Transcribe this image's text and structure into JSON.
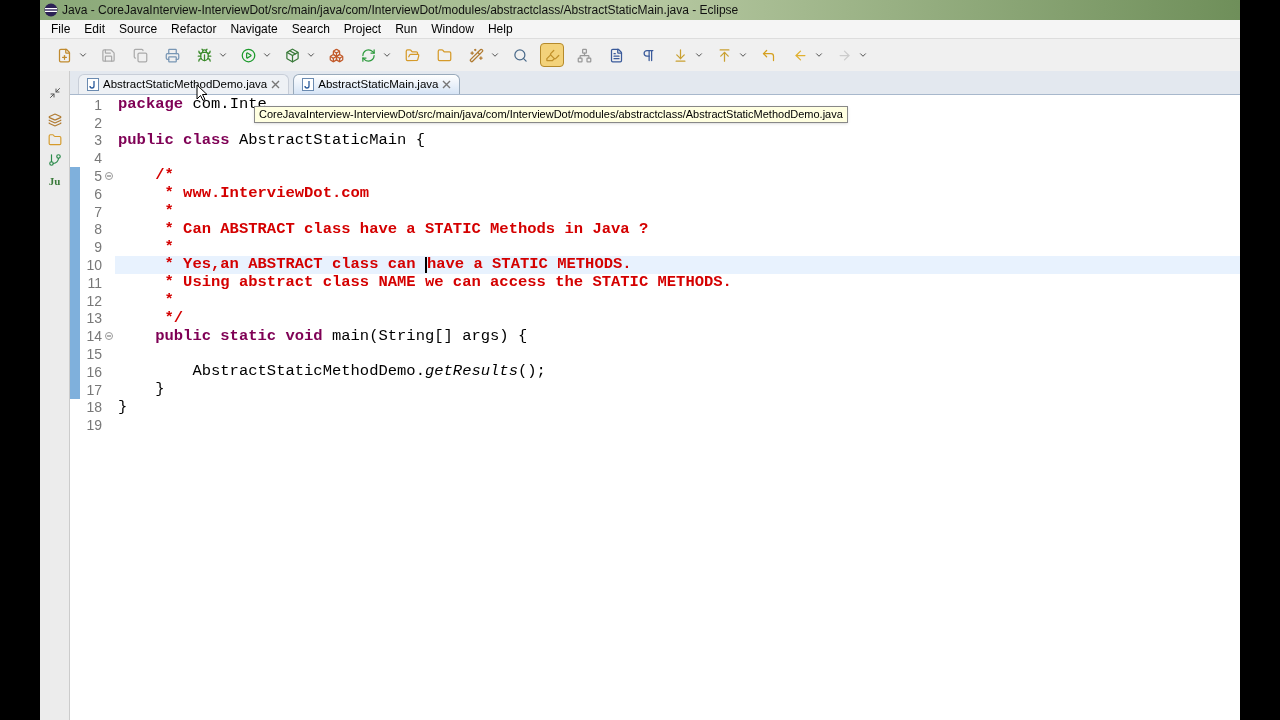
{
  "window": {
    "title": "Java - CoreJavaInterview-InterviewDot/src/main/java/com/InterviewDot/modules/abstractclass/AbstractStaticMain.java - Eclipse"
  },
  "menu": [
    "File",
    "Edit",
    "Source",
    "Refactor",
    "Navigate",
    "Search",
    "Project",
    "Run",
    "Window",
    "Help"
  ],
  "toolbar": {
    "mark_occurrences_on": true
  },
  "trim_bar": {
    "label": "Ju"
  },
  "tabs": [
    {
      "label": "AbstractStaticMethodDemo.java",
      "selected": false
    },
    {
      "label": "AbstractStaticMain.java",
      "selected": true
    }
  ],
  "tooltip": "CoreJavaInterview-InterviewDot/src/main/java/com/InterviewDot/modules/abstractclass/AbstractStaticMethodDemo.java",
  "editor": {
    "lines": [
      {
        "number": "1",
        "marked": false,
        "current": false,
        "fold": false,
        "tokens": [
          {
            "kind": "keyword",
            "text": "package"
          },
          {
            "kind": "plain",
            "text": " com.Inte"
          }
        ]
      },
      {
        "number": "2",
        "marked": false,
        "current": false,
        "fold": false
      },
      {
        "number": "3",
        "marked": false,
        "current": false,
        "fold": false,
        "tokens": [
          {
            "kind": "keyword",
            "text": "public class"
          },
          {
            "kind": "plain",
            "text": " AbstractStaticMain {"
          }
        ]
      },
      {
        "number": "4",
        "marked": false,
        "current": false,
        "fold": false
      },
      {
        "number": "5",
        "marked": true,
        "current": false,
        "fold": true,
        "tokens": [
          {
            "kind": "comment",
            "text": "    /*"
          }
        ]
      },
      {
        "number": "6",
        "marked": true,
        "current": false,
        "fold": false,
        "tokens": [
          {
            "kind": "comment",
            "text": "     * www.InterviewDot.com"
          }
        ]
      },
      {
        "number": "7",
        "marked": true,
        "current": false,
        "fold": false,
        "tokens": [
          {
            "kind": "comment",
            "text": "     *"
          }
        ]
      },
      {
        "number": "8",
        "marked": true,
        "current": false,
        "fold": false,
        "tokens": [
          {
            "kind": "comment",
            "text": "     * Can ABSTRACT class have a STATIC Methods in Java ?"
          }
        ]
      },
      {
        "number": "9",
        "marked": true,
        "current": false,
        "fold": false,
        "tokens": [
          {
            "kind": "comment",
            "text": "     *"
          }
        ]
      },
      {
        "number": "10",
        "marked": true,
        "current": true,
        "fold": false,
        "tokens": [
          {
            "kind": "comment",
            "text": "     * Yes,an ABSTRACT class can "
          },
          {
            "kind": "caret"
          },
          {
            "kind": "comment",
            "text": "have a STATIC METHODS."
          }
        ]
      },
      {
        "number": "11",
        "marked": true,
        "current": false,
        "fold": false,
        "tokens": [
          {
            "kind": "comment",
            "text": "     * Using abstract class NAME we can access the STATIC METHODS."
          }
        ]
      },
      {
        "number": "12",
        "marked": true,
        "current": false,
        "fold": false,
        "tokens": [
          {
            "kind": "comment",
            "text": "     *"
          }
        ]
      },
      {
        "number": "13",
        "marked": true,
        "current": false,
        "fold": false,
        "tokens": [
          {
            "kind": "comment",
            "text": "     */"
          }
        ]
      },
      {
        "number": "14",
        "marked": true,
        "current": false,
        "fold": true,
        "tokens": [
          {
            "kind": "keyword",
            "text": "    public static void"
          },
          {
            "kind": "plain",
            "text": " main(String[] args) {"
          }
        ]
      },
      {
        "number": "15",
        "marked": true,
        "current": false,
        "fold": false
      },
      {
        "number": "16",
        "marked": true,
        "current": false,
        "fold": false,
        "tokens": [
          {
            "kind": "plain",
            "text": "        AbstractStaticMethodDemo."
          },
          {
            "kind": "method",
            "text": "getResults"
          },
          {
            "kind": "plain",
            "text": "();"
          }
        ]
      },
      {
        "number": "17",
        "marked": true,
        "current": false,
        "fold": false,
        "tokens": [
          {
            "kind": "plain",
            "text": "    }"
          }
        ]
      },
      {
        "number": "18",
        "marked": false,
        "current": false,
        "fold": false,
        "tokens": [
          {
            "kind": "plain",
            "text": "}"
          }
        ]
      },
      {
        "number": "19",
        "marked": false,
        "current": false,
        "fold": false
      }
    ]
  }
}
